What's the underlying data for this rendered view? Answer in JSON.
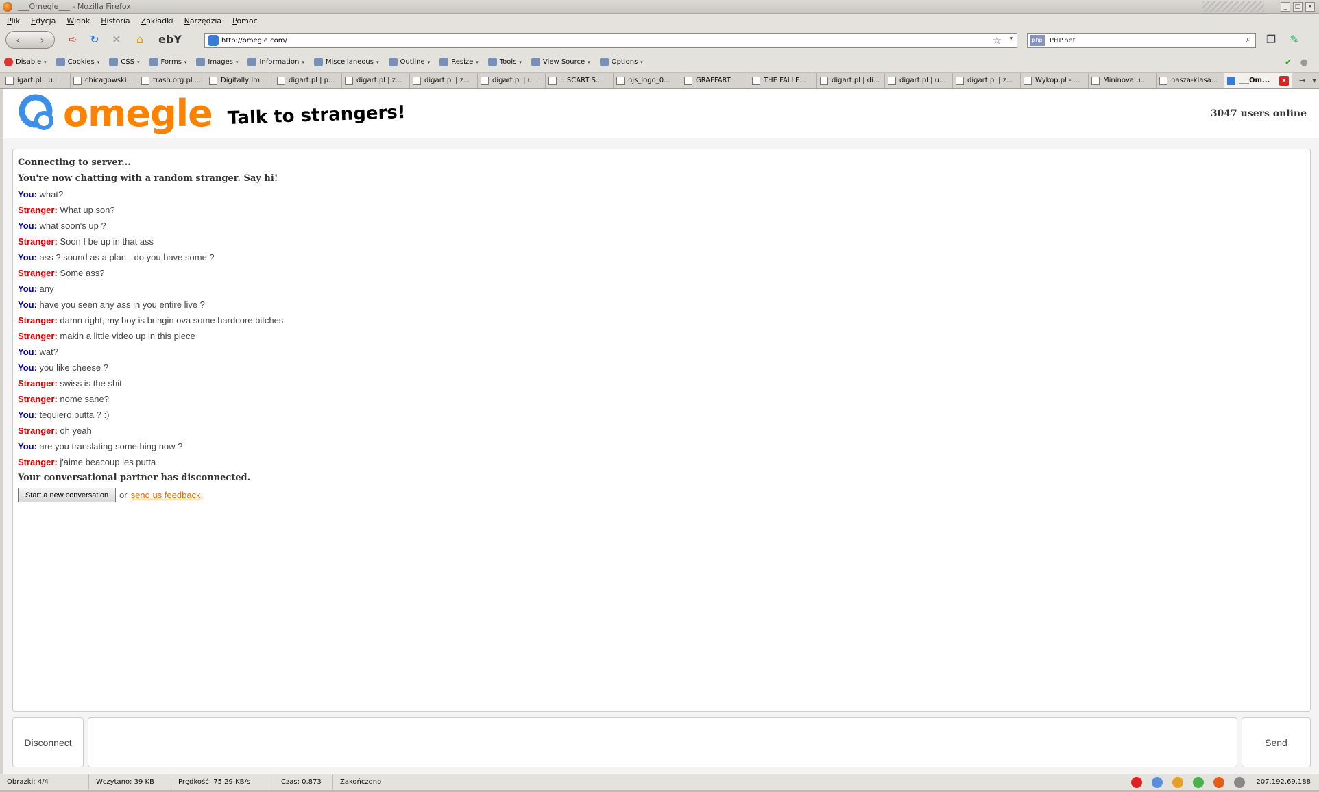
{
  "window": {
    "title": "___Omegle___ - Mozilla Firefox"
  },
  "menu": [
    "Plik",
    "Edycja",
    "Widok",
    "Historia",
    "Zakładki",
    "Narzędzia",
    "Pomoc"
  ],
  "nav": {
    "url": "http://omegle.com/",
    "search_text": "PHP.net",
    "search_engine": "php"
  },
  "devbar": [
    "Disable",
    "Cookies",
    "CSS",
    "Forms",
    "Images",
    "Information",
    "Miscellaneous",
    "Outline",
    "Resize",
    "Tools",
    "View Source",
    "Options"
  ],
  "tabs": [
    "igart.pl | u...",
    "chicagowski...",
    "trash.org.pl ...",
    "Digitally Im...",
    "digart.pl | p...",
    "digart.pl | z...",
    "digart.pl | z...",
    "digart.pl | u...",
    ":: SCART S...",
    "njs_logo_0...",
    "GRAFFART",
    "THE FALLE...",
    "digart.pl | di...",
    "digart.pl | u...",
    "digart.pl | z...",
    "Wykop.pl - ...",
    "Mininova u...",
    "nasza-klasa...",
    "___Om..."
  ],
  "omegle": {
    "logo_text": "omegle",
    "tagline": "Talk to strangers!",
    "users_online": "3047 users online",
    "brand_color": "#ff8100"
  },
  "chat": {
    "status_connecting": "Connecting to server...",
    "status_connected": "You're now chatting with a random stranger. Say hi!",
    "messages": [
      {
        "who": "You:",
        "text": "what?"
      },
      {
        "who": "Stranger:",
        "text": "What up son?"
      },
      {
        "who": "You:",
        "text": "what soon's up ?"
      },
      {
        "who": "Stranger:",
        "text": "Soon I be up in that ass"
      },
      {
        "who": "You:",
        "text": "ass ? sound as a plan - do you have some ?"
      },
      {
        "who": "Stranger:",
        "text": "Some ass?"
      },
      {
        "who": "You:",
        "text": "any"
      },
      {
        "who": "You:",
        "text": "have you seen any ass in you entire live ?"
      },
      {
        "who": "Stranger:",
        "text": "damn right, my boy is bringin ova some hardcore bitches"
      },
      {
        "who": "Stranger:",
        "text": "makin a little video up in this piece"
      },
      {
        "who": "You:",
        "text": "wat?"
      },
      {
        "who": "You:",
        "text": "you like cheese ?"
      },
      {
        "who": "Stranger:",
        "text": "swiss is the shit"
      },
      {
        "who": "Stranger:",
        "text": "nome sane?"
      },
      {
        "who": "You:",
        "text": "tequiero putta ? :)"
      },
      {
        "who": "Stranger:",
        "text": "oh yeah"
      },
      {
        "who": "You:",
        "text": "are you translating something now ?"
      },
      {
        "who": "Stranger:",
        "text": "j'aime beacoup les putta"
      }
    ],
    "status_disconnected": "Your conversational partner has disconnected.",
    "new_conversation_label": "Start a new conversation",
    "or_text": "or",
    "feedback_link": "send us feedback",
    "period": "."
  },
  "controls": {
    "disconnect_label": "Disconnect",
    "send_label": "Send",
    "input_value": ""
  },
  "statusbar": {
    "images": "Obrazki: 4/4",
    "loaded": "Wczytano: 39 KB",
    "speed": "Prędkość: 75.29 KB/s",
    "time": "Czas: 0.873",
    "state": "Zakończono",
    "ip": "207.192.69.188"
  }
}
